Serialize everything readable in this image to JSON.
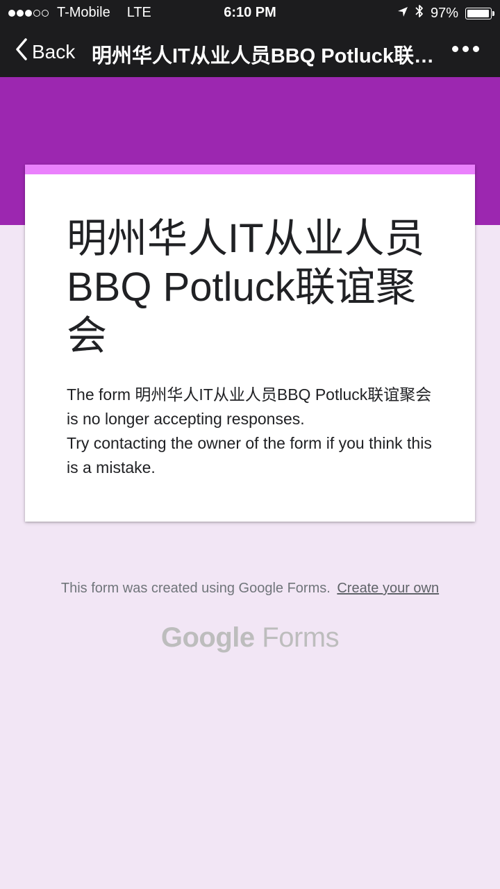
{
  "status_bar": {
    "carrier": "T-Mobile",
    "network": "LTE",
    "time": "6:10 PM",
    "battery_percent": "97%",
    "battery_level": 0.97,
    "location_icon": "location-arrow-icon",
    "bluetooth_icon": "bluetooth-icon"
  },
  "nav": {
    "back_label": "Back",
    "title": "明州华人IT从业人员BBQ Potluck联谊聚会",
    "more_icon": "more-dots-icon"
  },
  "colors": {
    "header_band": "#9c27b0",
    "card_accent": "#ea80fc",
    "page_background": "#f2e6f5"
  },
  "form": {
    "title": "明州华人IT从业人员BBQ Potluck联谊聚会",
    "closed_message": "The form 明州华人IT从业人员BBQ Potluck联谊聚会 is no longer accepting responses.",
    "contact_message": "Try contacting the owner of the form if you think this is a mistake."
  },
  "footer": {
    "created_with": "This form was created using Google Forms.",
    "create_link": "Create your own",
    "logo_word_1": "Google",
    "logo_word_2": "Forms"
  }
}
